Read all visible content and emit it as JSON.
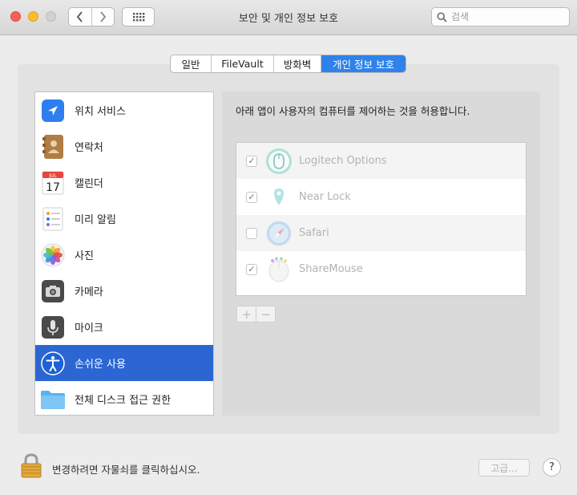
{
  "window": {
    "title": "보안 및 개인 정보 보호"
  },
  "search": {
    "placeholder": "검색"
  },
  "tabs": [
    {
      "label": "일반",
      "active": false
    },
    {
      "label": "FileVault",
      "active": false
    },
    {
      "label": "방화벽",
      "active": false
    },
    {
      "label": "개인 정보 보호",
      "active": true
    }
  ],
  "categories": [
    {
      "label": "위치 서비스",
      "icon": "location-icon"
    },
    {
      "label": "연락처",
      "icon": "contacts-icon"
    },
    {
      "label": "캘린더",
      "icon": "calendar-icon",
      "icon_month": "JUL",
      "icon_day": "17"
    },
    {
      "label": "미리 알림",
      "icon": "reminders-icon"
    },
    {
      "label": "사진",
      "icon": "photos-icon"
    },
    {
      "label": "카메라",
      "icon": "camera-icon"
    },
    {
      "label": "마이크",
      "icon": "microphone-icon"
    },
    {
      "label": "손쉬운 사용",
      "icon": "accessibility-icon",
      "selected": true
    },
    {
      "label": "전체 디스크 접근 권한",
      "icon": "folder-icon"
    }
  ],
  "main": {
    "description": "아래 앱이 사용자의 컴퓨터를 제어하는 것을 허용합니다.",
    "apps": [
      {
        "name": "Logitech Options",
        "checked": true,
        "icon": "logitech-options-icon"
      },
      {
        "name": "Near Lock",
        "checked": true,
        "icon": "near-lock-icon"
      },
      {
        "name": "Safari",
        "checked": false,
        "icon": "safari-icon"
      },
      {
        "name": "ShareMouse",
        "checked": true,
        "icon": "sharemouse-icon"
      }
    ],
    "add_label": "+",
    "remove_label": "−",
    "check_mark": "✓"
  },
  "footer": {
    "lock_text": "변경하려면 자물쇠를 클릭하십시오.",
    "advanced_label": "고급...",
    "help_label": "?"
  },
  "colors": {
    "accent": "#2f82ea",
    "selection": "#2c66d3"
  }
}
